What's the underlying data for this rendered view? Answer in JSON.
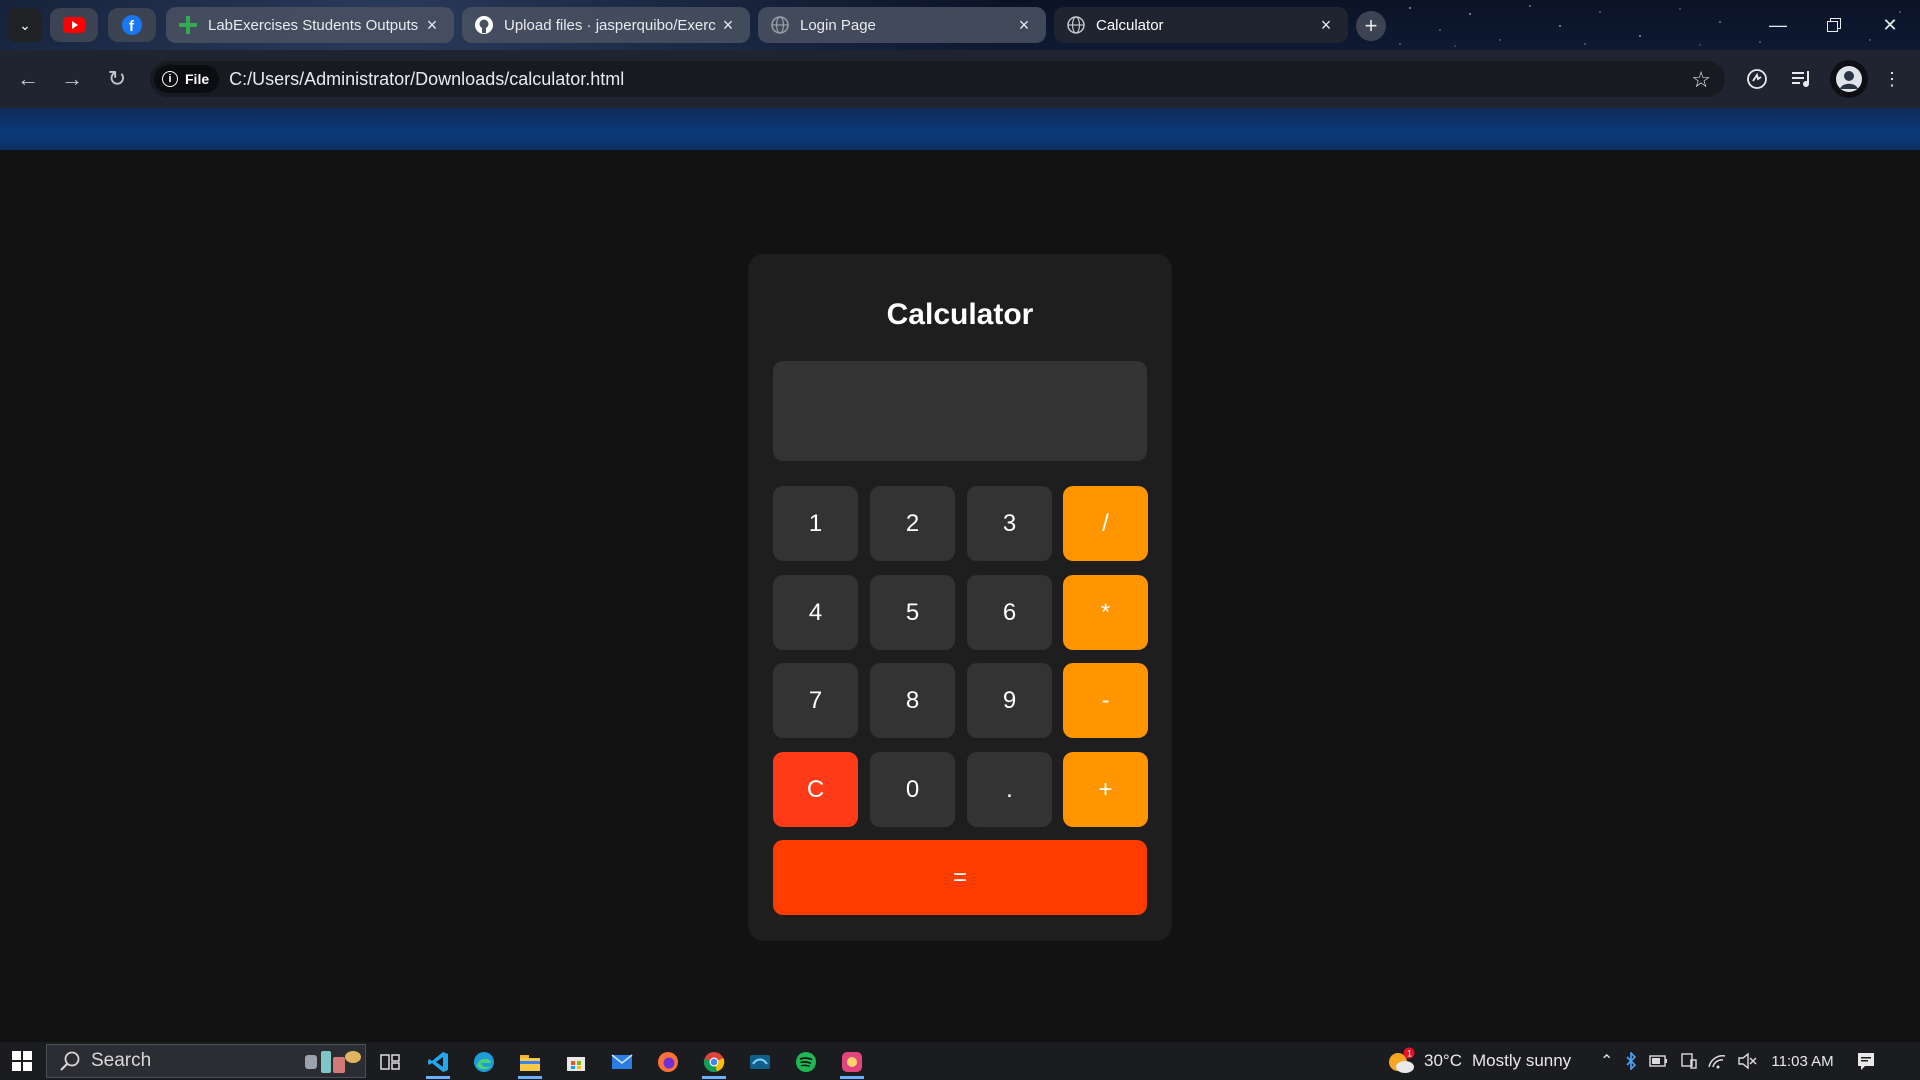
{
  "browser": {
    "tabs": [
      {
        "title": "LabExercises Students Outputs",
        "icon": "sheets-plus-icon",
        "active": false
      },
      {
        "title": "Upload files · jasperquibo/Exerc",
        "icon": "github-icon",
        "active": false
      },
      {
        "title": "Login Page",
        "icon": "globe-icon",
        "active": false
      },
      {
        "title": "Calculator",
        "icon": "globe-icon",
        "active": true
      }
    ],
    "address": {
      "chip_label": "File",
      "url": "C:/Users/Administrator/Downloads/calculator.html"
    }
  },
  "calculator": {
    "title": "Calculator",
    "display_value": "",
    "buttons": {
      "b1": "1",
      "b2": "2",
      "b3": "3",
      "div": "/",
      "b4": "4",
      "b5": "5",
      "b6": "6",
      "mul": "*",
      "b7": "7",
      "b8": "8",
      "b9": "9",
      "sub": "-",
      "clear": "C",
      "b0": "0",
      "dot": ".",
      "add": "+",
      "equals": "="
    },
    "colors": {
      "number": "#333333",
      "operator": "#ff9500",
      "clear": "#ff3b1a",
      "equals": "#ff3c00"
    }
  },
  "taskbar": {
    "search_placeholder": "Search",
    "weather_temp": "30°C",
    "weather_text": "Mostly sunny",
    "weather_badge": "1",
    "time": "11:03 AM"
  }
}
